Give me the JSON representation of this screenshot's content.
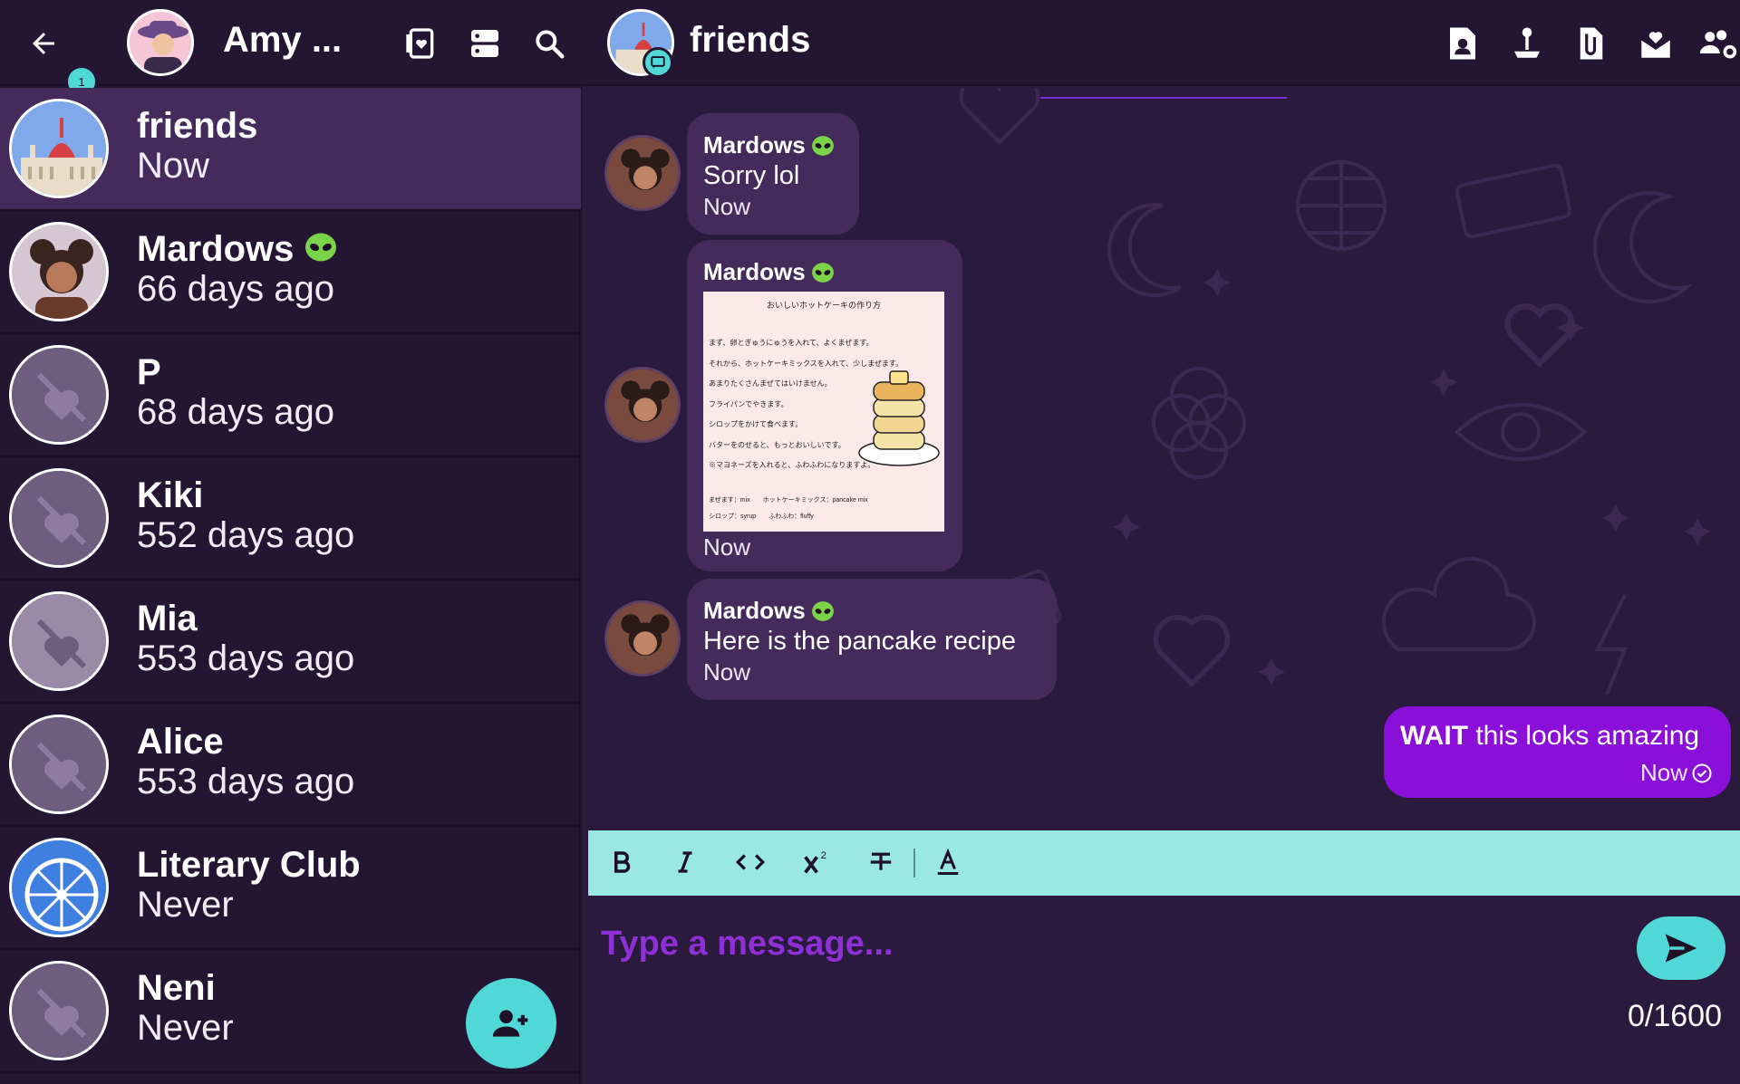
{
  "left_header": {
    "back_badge": "1",
    "user_name": "Amy ..."
  },
  "chats": [
    {
      "name": "friends",
      "time": "Now"
    },
    {
      "name": "Mardows",
      "time": "66 days ago"
    },
    {
      "name": "P",
      "time": "68 days ago"
    },
    {
      "name": "Kiki",
      "time": "552 days ago"
    },
    {
      "name": "Mia",
      "time": "553 days ago"
    },
    {
      "name": "Alice",
      "time": "553 days ago"
    },
    {
      "name": "Literary Club",
      "time": "Never"
    },
    {
      "name": "Neni",
      "time": "Never"
    }
  ],
  "conversation": {
    "title": "friends",
    "messages": [
      {
        "sender": "Mardows",
        "text": "Sorry lol",
        "time": "Now"
      },
      {
        "sender": "Mardows",
        "text": "",
        "time": "Now"
      },
      {
        "sender": "Mardows",
        "text": "Here is the pancake recipe",
        "time": "Now"
      }
    ],
    "own_message": {
      "text_bold": "WAIT",
      "text_rest": " this looks amazing",
      "time": "Now"
    }
  },
  "recipe_image": {
    "title": "おいしいホットケーキの作り方",
    "lines": [
      "まず、卵とぎゅうにゅうを入れて、よくまぜます。",
      "それから、ホットケーキミックスを入れて、少しまぜます。",
      "あまりたくさんまぜてはいけません。",
      "フライパンでやきます。",
      "シロップをかけて食べます。",
      "バターをのせると、もっとおいしいです。",
      "※マヨネーズを入れると、ふわふわになりますよ。"
    ],
    "glossary": [
      "まぜます：mix　　ホットケーキミックス：pancake mix",
      "シロップ：syrup　　ふわふわ：fluffy"
    ]
  },
  "composer": {
    "placeholder": "Type a message...",
    "char_count": "0/1600"
  },
  "colors": {
    "bg": "#241633",
    "active_item": "#442b5c",
    "accent_teal": "#4fd8d5",
    "own_bubble": "#8a0fd8",
    "toolbar": "#99e8e6"
  }
}
